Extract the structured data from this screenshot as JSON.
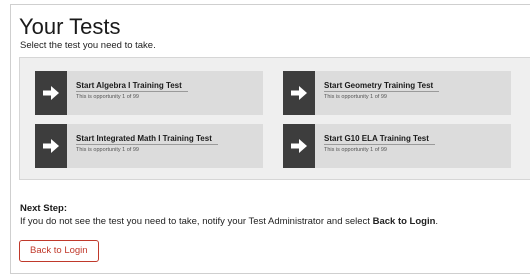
{
  "header": {
    "title": "Your Tests",
    "subtitle": "Select the test you need to take."
  },
  "tests": [
    {
      "title": "Start Algebra I Training Test",
      "subtitle": "This is opportunity 1 of 99",
      "icon": "arrow-right-icon"
    },
    {
      "title": "Start Geometry Training Test",
      "subtitle": "This is opportunity 1 of 99",
      "icon": "arrow-right-icon"
    },
    {
      "title": "Start Integrated Math I Training Test",
      "subtitle": "This is opportunity 1 of 99",
      "icon": "arrow-right-icon"
    },
    {
      "title": "Start G10 ELA Training Test",
      "subtitle": "This is opportunity 1 of 99",
      "icon": "arrow-right-icon"
    }
  ],
  "next_step": {
    "heading": "Next Step:",
    "text_before": "If you do not see the test you need to take, notify your Test Administrator and select ",
    "text_bold": "Back to Login",
    "text_after": "."
  },
  "back_button": {
    "label": "Back to Login"
  },
  "colors": {
    "card_bg": "#dcdcdc",
    "arrow_bg": "#3d3d3d",
    "button_accent": "#c0392b"
  }
}
